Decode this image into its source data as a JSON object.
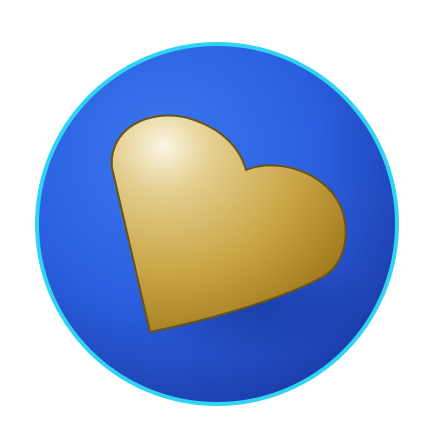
{
  "icon": {
    "name": "heart-icon",
    "colors": {
      "background": "#ffffff",
      "ring": "#2fd3f3",
      "disc_light": "#3a78ee",
      "disc_mid": "#2a5fdf",
      "disc_dark": "#1b3aa6",
      "heart_highlight": "#fbf6e4",
      "heart_light": "#e4cf8f",
      "heart_mid": "#c9a545",
      "heart_dark": "#9e7818",
      "heart_outline": "#6b5314"
    }
  }
}
